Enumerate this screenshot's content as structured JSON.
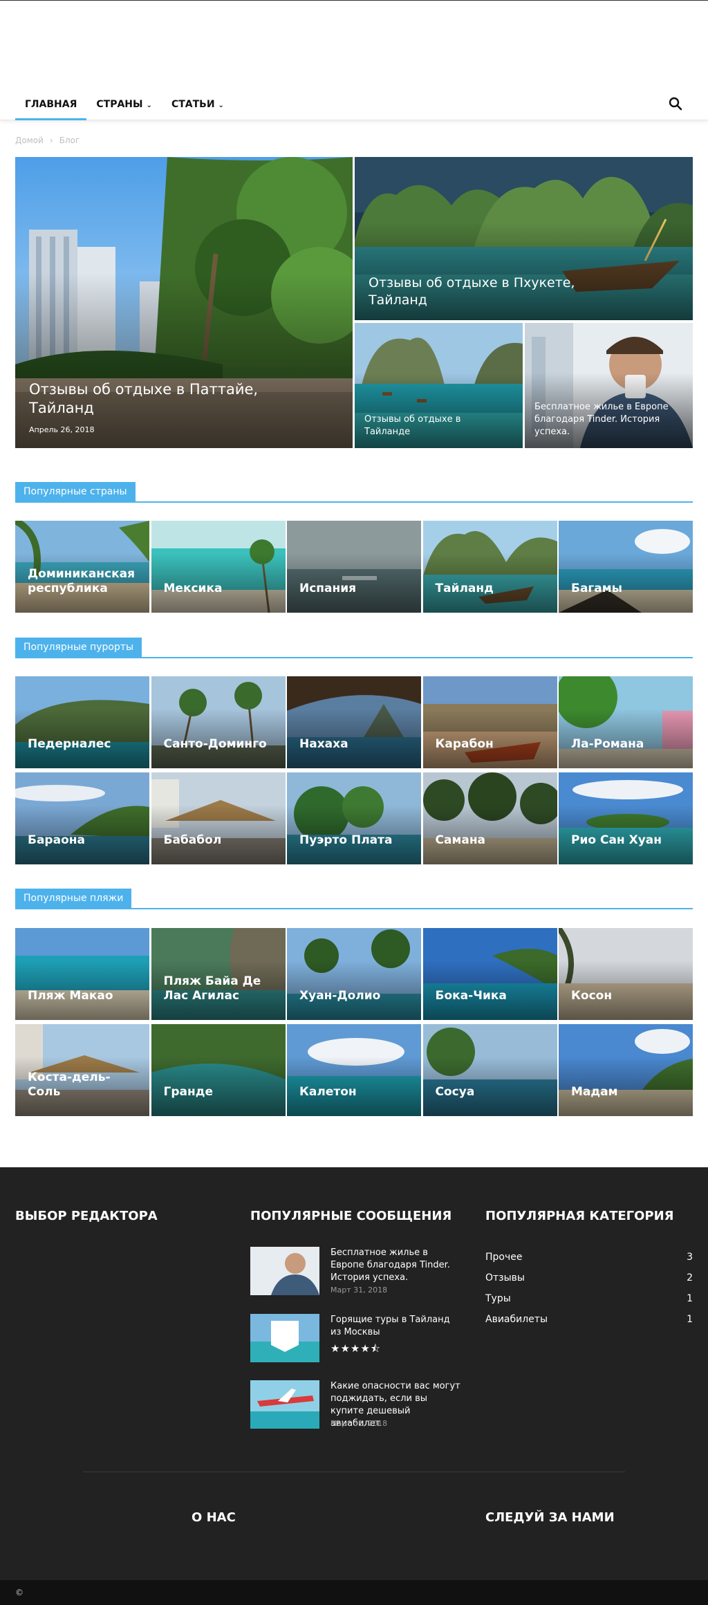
{
  "nav": {
    "items": [
      {
        "label": "ГЛАВНАЯ",
        "has_dropdown": false,
        "active": true
      },
      {
        "label": "СТРАНЫ",
        "has_dropdown": true,
        "active": false
      },
      {
        "label": "СТАТЬИ",
        "has_dropdown": true,
        "active": false
      }
    ],
    "search_icon": "search-icon",
    "accent": "#4db2ec"
  },
  "breadcrumb": {
    "home": "Домой",
    "separator": "›",
    "current": "Блог"
  },
  "hero": {
    "main": {
      "title": "Отзывы об отдыхе в Паттайе, Тайланд",
      "date": "Апрель 26, 2018"
    },
    "top_right": {
      "title": "Отзывы об отдыхе в Пхукете, Тайланд"
    },
    "bottom_left": {
      "title": "Отзывы об отдыхе в Тайланде"
    },
    "bottom_right": {
      "title": "Бесплатное жилье в Европе благодаря Tinder. История успеха."
    }
  },
  "sections": {
    "countries": {
      "title": "Популярные страны",
      "items": [
        "Доминиканская республика",
        "Мексика",
        "Испания",
        "Тайланд",
        "Багамы"
      ]
    },
    "resorts": {
      "title": "Популярные пурорты",
      "items": [
        "Педерналес",
        "Санто-Доминго",
        "Нахаха",
        "Карабон",
        "Ла-Романа",
        "Бараона",
        "Бабабол",
        "Пуэрто Плата",
        "Самана",
        "Рио Сан Хуан"
      ]
    },
    "beaches": {
      "title": "Популярные пляжи",
      "items": [
        "Пляж Макао",
        "Пляж Байа Де Лас Агилас",
        "Хуан-Долио",
        "Бока-Чика",
        "Косон",
        "Коста-дель-Соль",
        "Гранде",
        "Калетон",
        "Сосуа",
        "Мадам"
      ]
    }
  },
  "footer": {
    "editor_title": "ВЫБОР РЕДАКТОРА",
    "popular_posts_title": "ПОПУЛЯРНЫЕ СООБЩЕНИЯ",
    "popular_category_title": "ПОПУЛЯРНАЯ КАТЕГОРИЯ",
    "posts": [
      {
        "title": "Бесплатное жилье в Европе благодаря Tinder. История успеха.",
        "date": "Март 31, 2018"
      },
      {
        "title": "Горящие туры в Тайланд из Москвы",
        "rating": 4.5
      },
      {
        "title": "Какие опасности вас могут поджидать, если вы купите дешевый авиабилет",
        "date": "Март 31, 2018"
      }
    ],
    "rating_stars": "★★★★⯪",
    "categories": [
      {
        "name": "Прочее",
        "count": "3"
      },
      {
        "name": "Отзывы",
        "count": "2"
      },
      {
        "name": "Туры",
        "count": "1"
      },
      {
        "name": "Авиабилеты",
        "count": "1"
      }
    ],
    "about_title": "О НАС",
    "follow_title": "СЛЕДУЙ ЗА НАМИ",
    "copyright": "©"
  }
}
